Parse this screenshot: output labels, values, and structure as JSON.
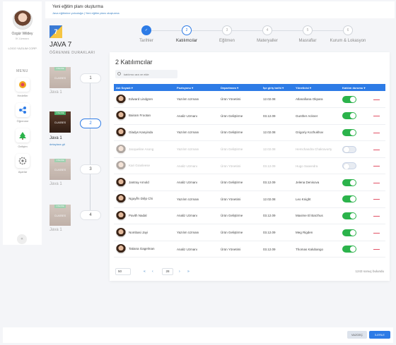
{
  "user": {
    "name": "Ozgür Wildey",
    "role": "İK Uzmanı",
    "company": "LOGO YAZILIM CORP."
  },
  "menu": {
    "title": "MENU",
    "items": [
      {
        "label": "Hedefler",
        "icon": "target-icon",
        "color": "#f0a91a"
      },
      {
        "label": "Öğrenme",
        "icon": "share-nodes-icon",
        "color": "#2d7be6"
      },
      {
        "label": "Gelişim",
        "icon": "tree-icon",
        "color": "#2bb34b"
      },
      {
        "label": "Ayarlar",
        "icon": "gear-icon",
        "color": "#777777"
      }
    ],
    "collapse": "«"
  },
  "header": {
    "title": "Yeni eğitim planı oluşturma",
    "breadcrumb": "Java eğitimine yolculuğa  |  Yeni eğitim planı oluşturma"
  },
  "course": {
    "logo": "7",
    "title": "JAVA 7",
    "subtitle": "ÖĞRENME DURAKLARI"
  },
  "steps": [
    {
      "num": "✓",
      "label": "Tarihler",
      "state": "done"
    },
    {
      "num": "2",
      "label": "Katılımcılar",
      "state": "active"
    },
    {
      "num": "3",
      "label": "Eğitmen",
      "state": ""
    },
    {
      "num": "4",
      "label": "Materyaller",
      "state": ""
    },
    {
      "num": "5",
      "label": "Masraflar",
      "state": ""
    },
    {
      "num": "6",
      "label": "Kurum & Lokasyon",
      "state": ""
    }
  ],
  "schedule": [
    {
      "day": "1",
      "tag": "ONLINE",
      "thumb": "CLASSES",
      "label": "Java 1",
      "link": ""
    },
    {
      "day": "2",
      "tag": "ONLINE",
      "thumb": "CLASSES",
      "label": "Java 1",
      "link": "detaylara git"
    },
    {
      "day": "3",
      "tag": "ONLINE",
      "thumb": "CLASSES",
      "label": "Java 1",
      "link": ""
    },
    {
      "day": "4",
      "tag": "ONLINE",
      "thumb": "CLASSES",
      "label": "Java 1",
      "link": ""
    }
  ],
  "participants": {
    "title": "2 Katılımcılar",
    "search_placeholder": "katılımcı ara ve ekle",
    "columns": [
      "Adı Soyadı ▾",
      "Pozisyonu ▾",
      "Departmanı ▾",
      "İşe giriş tarihi ▾",
      "Yöneticisi ▾",
      "Katılım durumu ▾",
      ""
    ],
    "rows": [
      {
        "name": "Edward Lindgren",
        "position": "Yazılım Uzmanı",
        "dept": "Ürün Yönetimi",
        "date": "12.02.08",
        "manager": "Atlanafiana Okpara",
        "on": true
      },
      {
        "name": "Bairam Frootan",
        "position": "Analiz Uzmanı",
        "dept": "Ürün Geliştirme",
        "date": "03.12.09",
        "manager": "Gunther Ackner",
        "on": true
      },
      {
        "name": "Gladys Kanyinda",
        "position": "Yazılım Uzmanı",
        "dept": "Ürün Geliştirme",
        "date": "12.02.08",
        "manager": "Grigoriy Kozhukhov",
        "on": true
      },
      {
        "name": "Jacqueline Asong",
        "position": "Yazılım Uzmanı",
        "dept": "Ürün Geliştirme",
        "date": "12.02.08",
        "manager": "Hemchandra Chakravorty",
        "on": false
      },
      {
        "name": "Kari Granleese",
        "position": "Analiz Uzmanı",
        "dept": "Ürün Yönetimi",
        "date": "03.12.09",
        "manager": "Hugo Saavedra",
        "on": false
      },
      {
        "name": "Jantray Arnold",
        "position": "Analiz Uzmanı",
        "dept": "Ürün Geliştirme",
        "date": "03.12.09",
        "manager": "Jelena Denisova",
        "on": true
      },
      {
        "name": "Nguyễn Diệp Chi",
        "position": "Yazılım Uzmanı",
        "dept": "Ürün Yönetimi",
        "date": "12.02.08",
        "manager": "Leo Knight",
        "on": true
      },
      {
        "name": "Pavith Nadal",
        "position": "Analiz Uzmanı",
        "dept": "Ürün Geliştirme",
        "date": "03.12.09",
        "manager": "Maxime El Barzhus",
        "on": true
      },
      {
        "name": "Nombasi Jayi",
        "position": "Yazılım Uzmanı",
        "dept": "Ürün Geliştirme",
        "date": "03.12.09",
        "manager": "Meg Rigden",
        "on": true
      },
      {
        "name": "Tatiana Gagelman",
        "position": "Analiz Uzmanı",
        "dept": "Ürün Yönetimi",
        "date": "03.12.09",
        "manager": "Thomas Kalubango",
        "on": true
      }
    ],
    "remove_label": "—",
    "pagination": {
      "page_size": "50",
      "first": "«",
      "prev": "‹",
      "page": "28",
      "next": "›",
      "last": "»",
      "results": "1243 sonuç bulundu"
    }
  },
  "footer": {
    "back": "VAZGEÇ",
    "next": "İLERLE"
  }
}
